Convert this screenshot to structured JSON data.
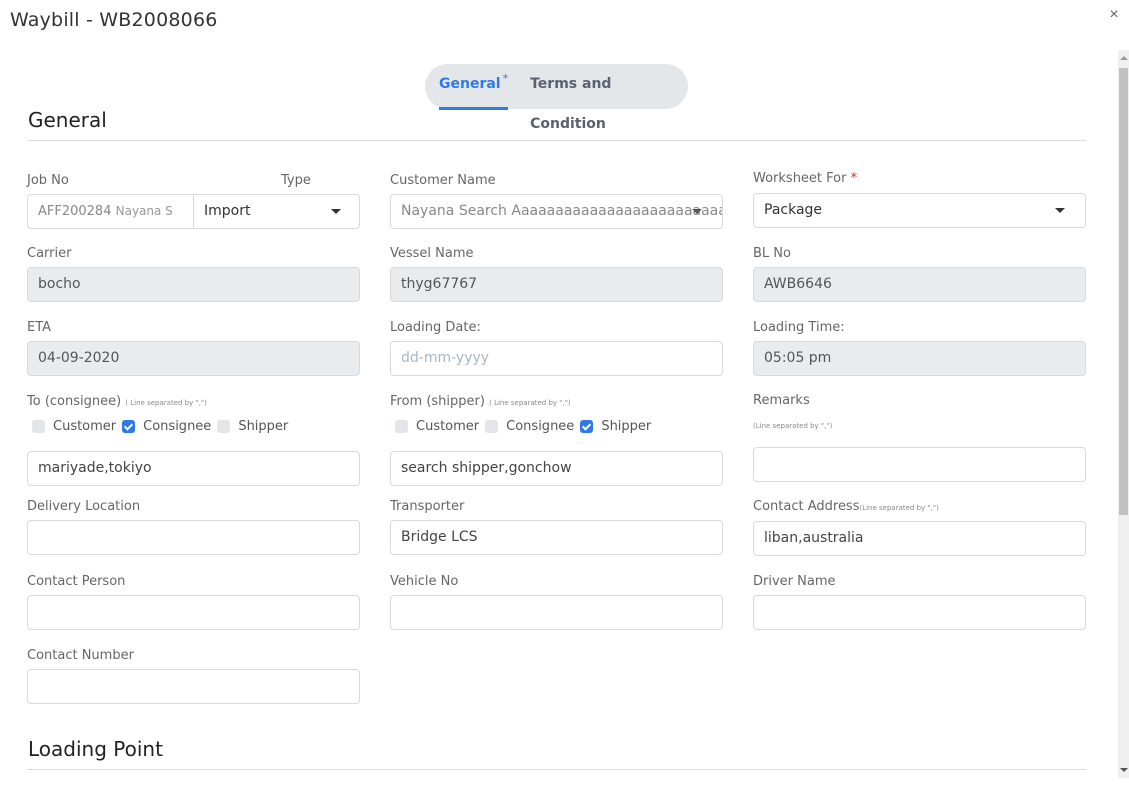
{
  "modal": {
    "title": "Waybill - WB2008066",
    "close_icon": "×"
  },
  "tabs": [
    {
      "label": "General",
      "asterisk": "*",
      "active": true
    },
    {
      "label": "Terms and Condition",
      "active": false
    }
  ],
  "sections": {
    "general": "General",
    "loading_point": "Loading Point"
  },
  "hint_text": "( Line separated by \",\")",
  "hint_text_alt": "(Line separated by \",\")",
  "fields": {
    "job_no": {
      "label": "Job No",
      "value": "AFF200284",
      "sub": "Nayana S"
    },
    "type": {
      "label": "Type",
      "value": "Import"
    },
    "customer_name": {
      "label": "Customer Name",
      "value": "Nayana Search Aaaaaaaaaaaaaaaaaaaaaaaaa"
    },
    "worksheet_for": {
      "label": "Worksheet For",
      "required": "*",
      "value": "Package"
    },
    "carrier": {
      "label": "Carrier",
      "value": "bocho"
    },
    "vessel_name": {
      "label": "Vessel Name",
      "value": "thyg67767"
    },
    "bl_no": {
      "label": "BL No",
      "value": "AWB6646"
    },
    "eta": {
      "label": "ETA",
      "value": "04-09-2020"
    },
    "loading_date": {
      "label": "Loading Date:",
      "placeholder": "dd-mm-yyyy",
      "value": ""
    },
    "loading_time": {
      "label": "Loading Time:",
      "value": "05:05 pm"
    },
    "to_consignee": {
      "label": "To (consignee)",
      "value": "mariyade,tokiyo",
      "options": [
        {
          "label": "Customer",
          "checked": false
        },
        {
          "label": "Consignee",
          "checked": true
        },
        {
          "label": "Shipper",
          "checked": false
        }
      ]
    },
    "from_shipper": {
      "label": "From (shipper)",
      "value": "search shipper,gonchow",
      "options": [
        {
          "label": "Customer",
          "checked": false
        },
        {
          "label": "Consignee",
          "checked": false
        },
        {
          "label": "Shipper",
          "checked": true
        }
      ]
    },
    "remarks": {
      "label": "Remarks",
      "value": ""
    },
    "delivery_location": {
      "label": "Delivery Location",
      "value": ""
    },
    "transporter": {
      "label": "Transporter",
      "value": "Bridge LCS"
    },
    "contact_address": {
      "label": "Contact Address",
      "value": "liban,australia"
    },
    "contact_person": {
      "label": "Contact Person",
      "value": ""
    },
    "vehicle_no": {
      "label": "Vehicle No",
      "value": ""
    },
    "driver_name": {
      "label": "Driver Name",
      "value": ""
    },
    "contact_number": {
      "label": "Contact Number",
      "value": ""
    }
  },
  "colors": {
    "accent": "#2f7ae5",
    "required": "#d32f2f",
    "disabled_bg": "#e9ecef",
    "tab_bg": "#e3e7ea"
  }
}
